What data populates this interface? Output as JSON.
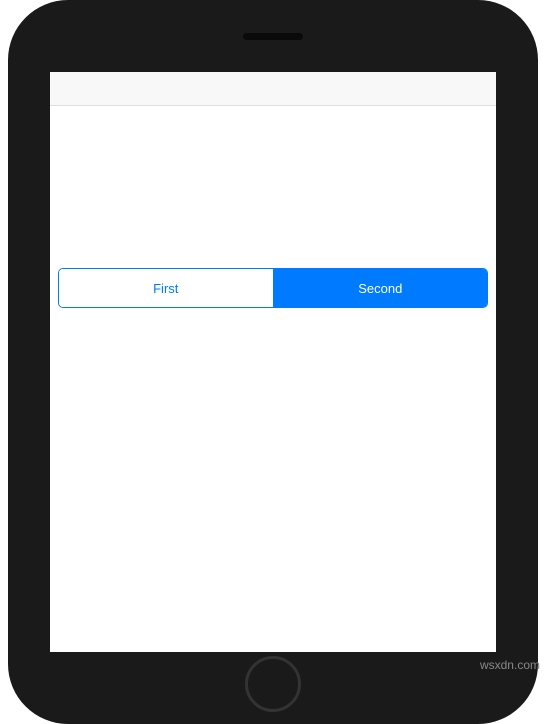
{
  "segmented_control": {
    "segments": [
      {
        "label": "First",
        "selected": false
      },
      {
        "label": "Second",
        "selected": true
      }
    ]
  },
  "colors": {
    "accent": "#007aff",
    "background": "#ffffff",
    "status_bar": "#f8f8f8",
    "frame": "#1a1a1a"
  },
  "watermark": "wsxdn.com"
}
